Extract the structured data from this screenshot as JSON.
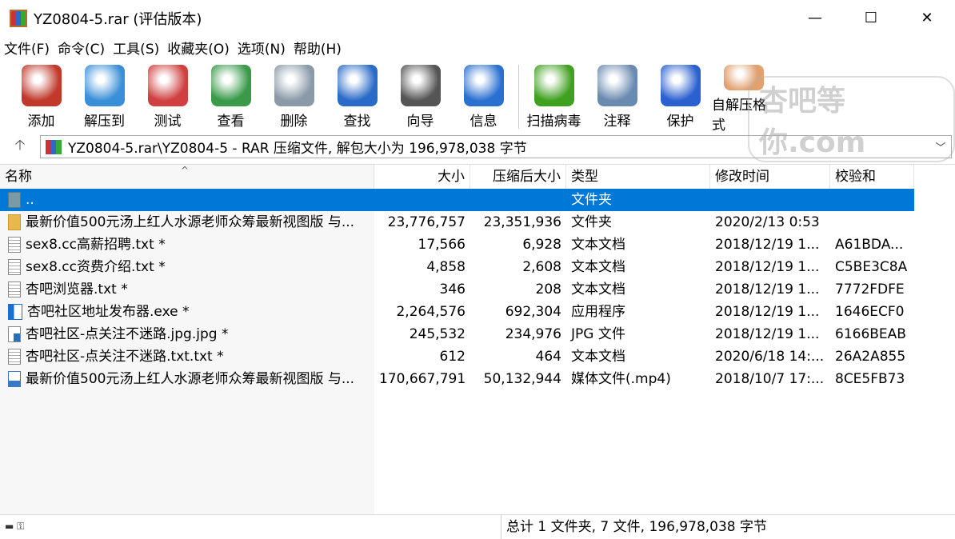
{
  "window": {
    "title": "YZ0804-5.rar (评估版本)",
    "minimize": "—",
    "maximize": "☐",
    "close": "✕"
  },
  "menu": [
    "文件(F)",
    "命令(C)",
    "工具(S)",
    "收藏夹(O)",
    "选项(N)",
    "帮助(H)"
  ],
  "toolbar": [
    {
      "label": "添加",
      "icon": "add-archive-icon",
      "color": "#c0392b"
    },
    {
      "label": "解压到",
      "icon": "extract-folder-icon",
      "color": "#3a8fd8"
    },
    {
      "label": "测试",
      "icon": "test-checklist-icon",
      "color": "#d04040"
    },
    {
      "label": "查看",
      "icon": "view-book-icon",
      "color": "#3a9a4a"
    },
    {
      "label": "删除",
      "icon": "trash-icon",
      "color": "#8a9aa8"
    },
    {
      "label": "查找",
      "icon": "search-magnifier-icon",
      "color": "#2a6ac8"
    },
    {
      "label": "向导",
      "icon": "wizard-wand-icon",
      "color": "#555555"
    },
    {
      "label": "信息",
      "icon": "info-icon",
      "color": "#2a70d0"
    },
    {
      "label": "扫描病毒",
      "icon": "virus-scan-icon",
      "color": "#40a020"
    },
    {
      "label": "注释",
      "icon": "comment-icon",
      "color": "#6a8ab0"
    },
    {
      "label": "保护",
      "icon": "shield-icon",
      "color": "#2a60d0"
    },
    {
      "label": "自解压格式",
      "icon": "sfx-box-icon",
      "color": "#e0a070"
    }
  ],
  "watermark": "杏吧等你.com",
  "address": {
    "up": "🡡",
    "path": "YZ0804-5.rar\\YZ0804-5 - RAR 压缩文件, 解包大小为 196,978,038 字节",
    "dropdown": "﹀"
  },
  "columns": {
    "name": "名称",
    "size": "大小",
    "packed": "压缩后大小",
    "type": "类型",
    "modified": "修改时间",
    "crc": "校验和",
    "sort_indicator": "^"
  },
  "files": [
    {
      "name": "..",
      "size": "",
      "packed": "",
      "type": "文件夹",
      "modified": "",
      "crc": "",
      "kind": "up",
      "selected": true
    },
    {
      "name": "最新价值500元汤上红人水源老师众筹最新视图版 与...",
      "size": "23,776,757",
      "packed": "23,351,936",
      "type": "文件夹",
      "modified": "2020/2/13 0:53",
      "crc": "",
      "kind": "folder"
    },
    {
      "name": "sex8.cc高薪招聘.txt *",
      "size": "17,566",
      "packed": "6,928",
      "type": "文本文档",
      "modified": "2018/12/19 1...",
      "crc": "A61BDA...",
      "kind": "txt"
    },
    {
      "name": "sex8.cc资费介绍.txt *",
      "size": "4,858",
      "packed": "2,608",
      "type": "文本文档",
      "modified": "2018/12/19 1...",
      "crc": "C5BE3C8A",
      "kind": "txt"
    },
    {
      "name": "杏吧浏览器.txt *",
      "size": "346",
      "packed": "208",
      "type": "文本文档",
      "modified": "2018/12/19 1...",
      "crc": "7772FDFE",
      "kind": "txt"
    },
    {
      "name": "杏吧社区地址发布器.exe *",
      "size": "2,264,576",
      "packed": "692,304",
      "type": "应用程序",
      "modified": "2018/12/19 1...",
      "crc": "1646ECF0",
      "kind": "exe"
    },
    {
      "name": "杏吧社区-点关注不迷路.jpg.jpg *",
      "size": "245,532",
      "packed": "234,976",
      "type": "JPG 文件",
      "modified": "2018/12/19 1...",
      "crc": "6166BEAB",
      "kind": "jpg"
    },
    {
      "name": "杏吧社区-点关注不迷路.txt.txt *",
      "size": "612",
      "packed": "464",
      "type": "文本文档",
      "modified": "2020/6/18 14:...",
      "crc": "26A2A855",
      "kind": "txt"
    },
    {
      "name": "最新价值500元汤上红人水源老师众筹最新视图版 与...",
      "size": "170,667,791",
      "packed": "50,132,944",
      "type": "媒体文件(.mp4)",
      "modified": "2018/10/7 17:...",
      "crc": "8CE5FB73",
      "kind": "mp4"
    }
  ],
  "status": {
    "left_icons": "▬ ⚿",
    "summary": "总计 1 文件夹, 7 文件, 196,978,038 字节"
  }
}
